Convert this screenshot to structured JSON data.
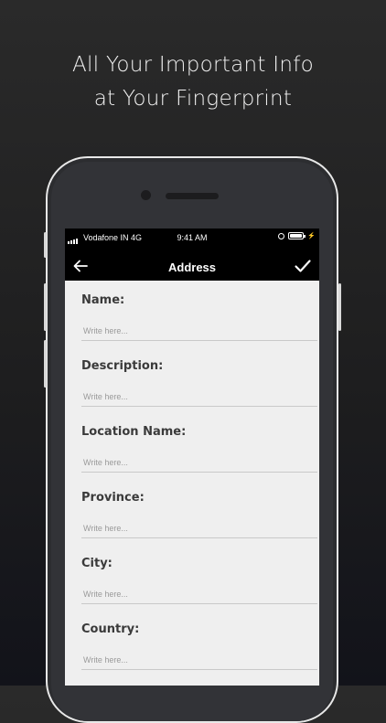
{
  "headline": {
    "line1": "All Your Important Info",
    "line2": "at Your Fingerprint"
  },
  "statusbar": {
    "carrier": "Vodafone IN  4G",
    "time": "9:41 AM",
    "icons": [
      "signal-icon",
      "lock-rotation-icon",
      "battery-icon",
      "charging-icon"
    ]
  },
  "navbar": {
    "title": "Address",
    "back_icon": "arrow-left-icon",
    "save_icon": "checkmark-icon"
  },
  "form": {
    "fields": [
      {
        "label": "Name:",
        "placeholder": "Write here..."
      },
      {
        "label": "Description:",
        "placeholder": "Write here..."
      },
      {
        "label": "Location Name:",
        "placeholder": "Write here..."
      },
      {
        "label": "Province:",
        "placeholder": "Write here..."
      },
      {
        "label": "City:",
        "placeholder": "Write here..."
      },
      {
        "label": "Country:",
        "placeholder": "Write here..."
      }
    ]
  },
  "colors": {
    "background": "#1e1e1f",
    "navbar": "#000000",
    "form_background": "#efefef",
    "label_text": "#3a3a3a",
    "placeholder_text": "#9a9a9a"
  }
}
